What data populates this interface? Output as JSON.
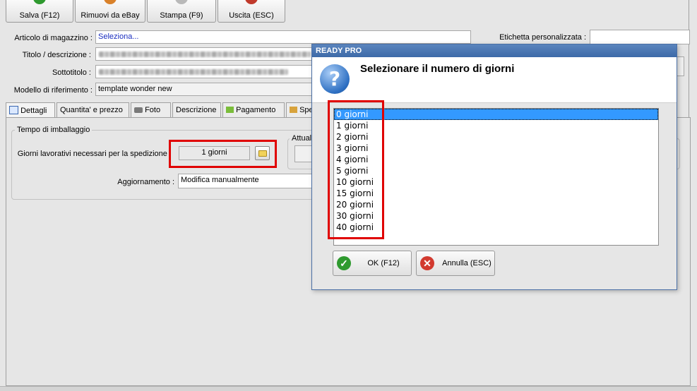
{
  "toolbar": {
    "save_label": "Salva (F12)",
    "remove_label": "Rimuovi da eBay",
    "print_label": "Stampa (F9)",
    "exit_label": "Uscita (ESC)"
  },
  "form": {
    "article_label": "Articolo di magazzino :",
    "article_value": "Seleziona...",
    "title_label": "Titolo / descrizione :",
    "subtitle_label": "Sottotitolo :",
    "model_label": "Modello di riferimento :",
    "model_value": "template wonder new",
    "custom_label_label": "Etichetta personalizzata :",
    "custom_label_value": ""
  },
  "tabs": [
    {
      "label": "Dettagli",
      "icon": "calendar-icon"
    },
    {
      "label": "Quantita' e prezzo"
    },
    {
      "label": "Foto",
      "icon": "camera-icon"
    },
    {
      "label": "Descrizione"
    },
    {
      "label": "Pagamento",
      "icon": "money-icon"
    },
    {
      "label": "Spe",
      "icon": "package-icon"
    }
  ],
  "packaging": {
    "group_title": "Tempo di imballaggio",
    "days_label": "Giorni lavorativi necessari per la spedizione :",
    "days_value": "1 giorni",
    "update_label": "Aggiornamento :",
    "update_value": "Modifica manualmente",
    "side_group_title": "Attual"
  },
  "dialog": {
    "title": "READY PRO",
    "heading": "Selezionare il numero di giorni",
    "options": [
      "0 giorni",
      "1 giorni",
      "2 giorni",
      "3 giorni",
      "4 giorni",
      "5 giorni",
      "10 giorni",
      "15 giorni",
      "20 giorni",
      "30 giorni",
      "40 giorni"
    ],
    "selected": "0 giorni",
    "ok_label": "OK (F12)",
    "cancel_label": "Annulla (ESC)"
  },
  "colors": {
    "highlight": "#e00000",
    "selection": "#3399ff",
    "title_bar": "#4a76b3",
    "link_text": "#1a2dbf"
  }
}
